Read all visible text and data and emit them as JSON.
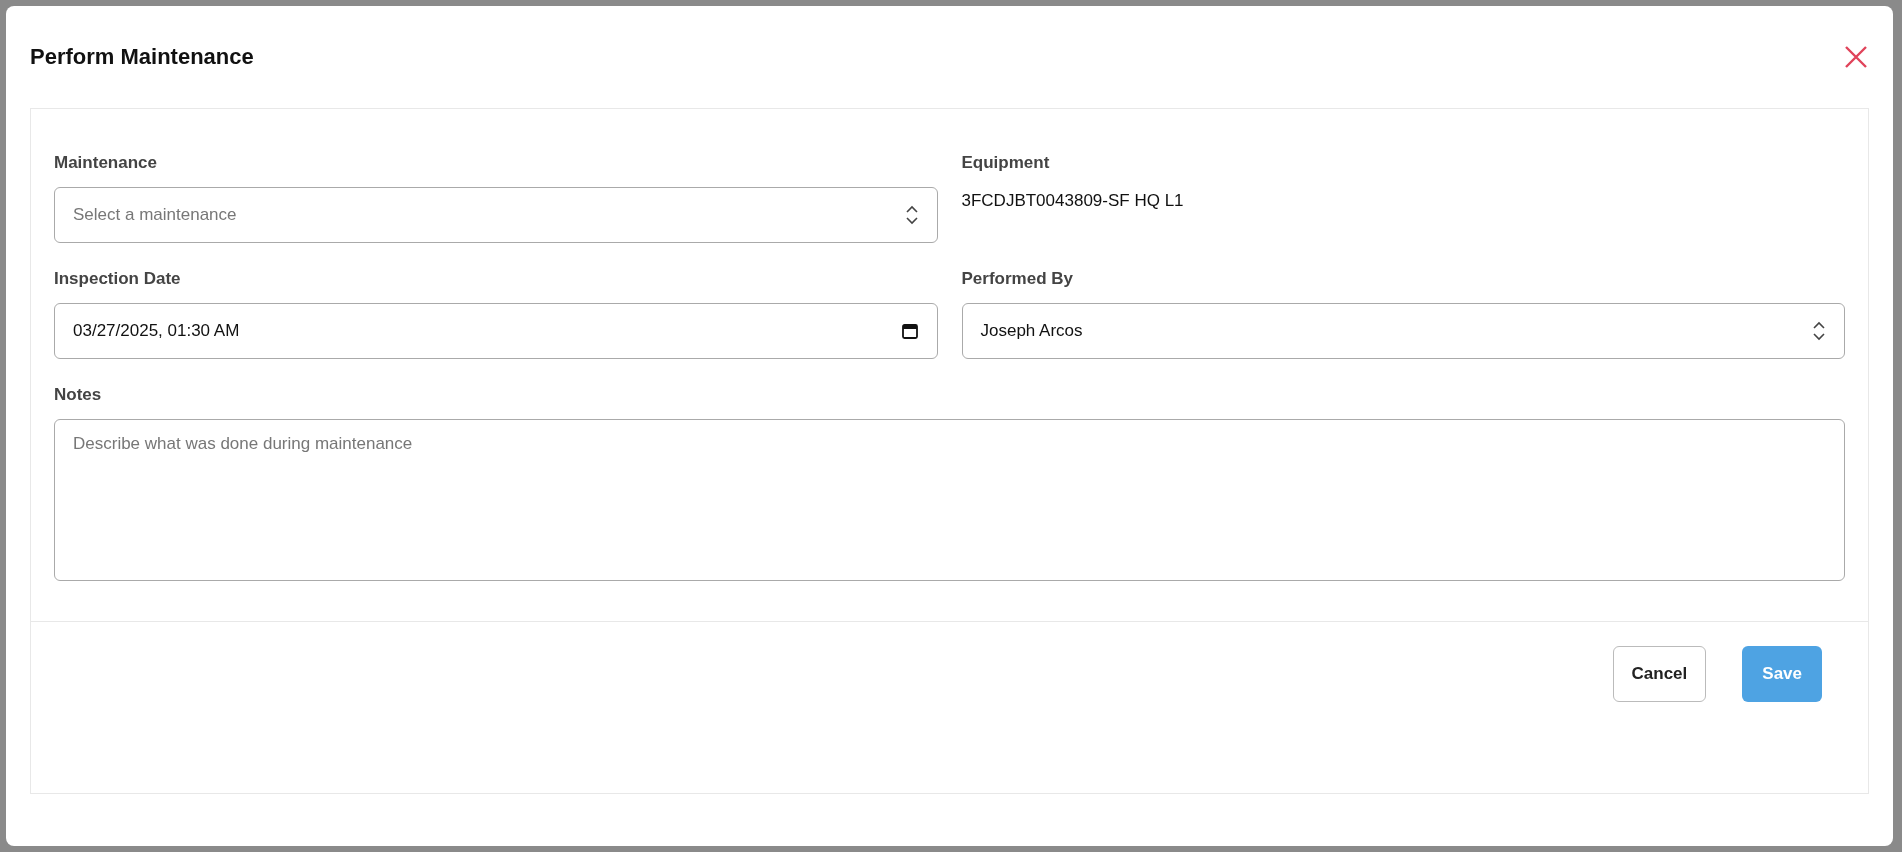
{
  "dialog": {
    "title": "Perform Maintenance"
  },
  "fields": [
    {
      "kind": "select",
      "label": "Maintenance",
      "placeholder": "Select a maintenance"
    },
    {
      "kind": "readonly",
      "label": "Equipment",
      "value": "3FCDJBT0043809-SF HQ L1"
    },
    {
      "kind": "datetime",
      "label": "Inspection Date",
      "value": "03/27/2025, 01:30 AM"
    },
    {
      "kind": "select",
      "label": "Performed By",
      "value": "Joseph Arcos"
    },
    {
      "kind": "textarea",
      "label": "Notes",
      "placeholder": "Describe what was done during maintenance"
    }
  ],
  "buttons": [
    {
      "label": "Cancel",
      "kind": "secondary"
    },
    {
      "label": "Save",
      "kind": "primary"
    }
  ]
}
